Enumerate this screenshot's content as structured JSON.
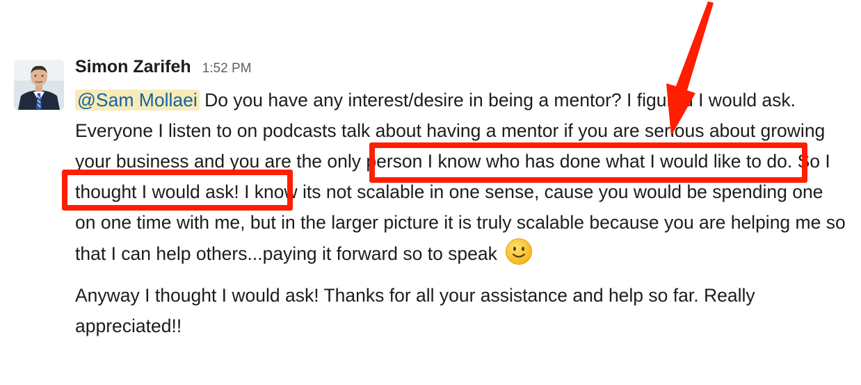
{
  "message": {
    "sender": "Simon Zarifeh",
    "timestamp": "1:52 PM",
    "mention": "@Sam Mollaei",
    "paragraph1": {
      "before_mention_gap": " ",
      "part_a": "Do you have any interest/desire in being a mentor? I figured I would ask. Everyone I listen to on podcasts talk about having a mentor if you are serious about growing your business and ",
      "part_b": "you are the only person I know who has done what I would like to do",
      "part_c": ". So I thought I would ask! I know its not scalable in one sense, cause you would be spending one on one time with me, but in the larger picture it is truly scalable because you are helping me so that I can help others...paying it forward so to speak "
    },
    "paragraph2": "Anyway I thought I would ask! Thanks for all your assistance and help so far. Really appreciated!!",
    "emoji": "slightly-smiling-face"
  },
  "annotations": {
    "highlight_color": "#ff1e00"
  }
}
